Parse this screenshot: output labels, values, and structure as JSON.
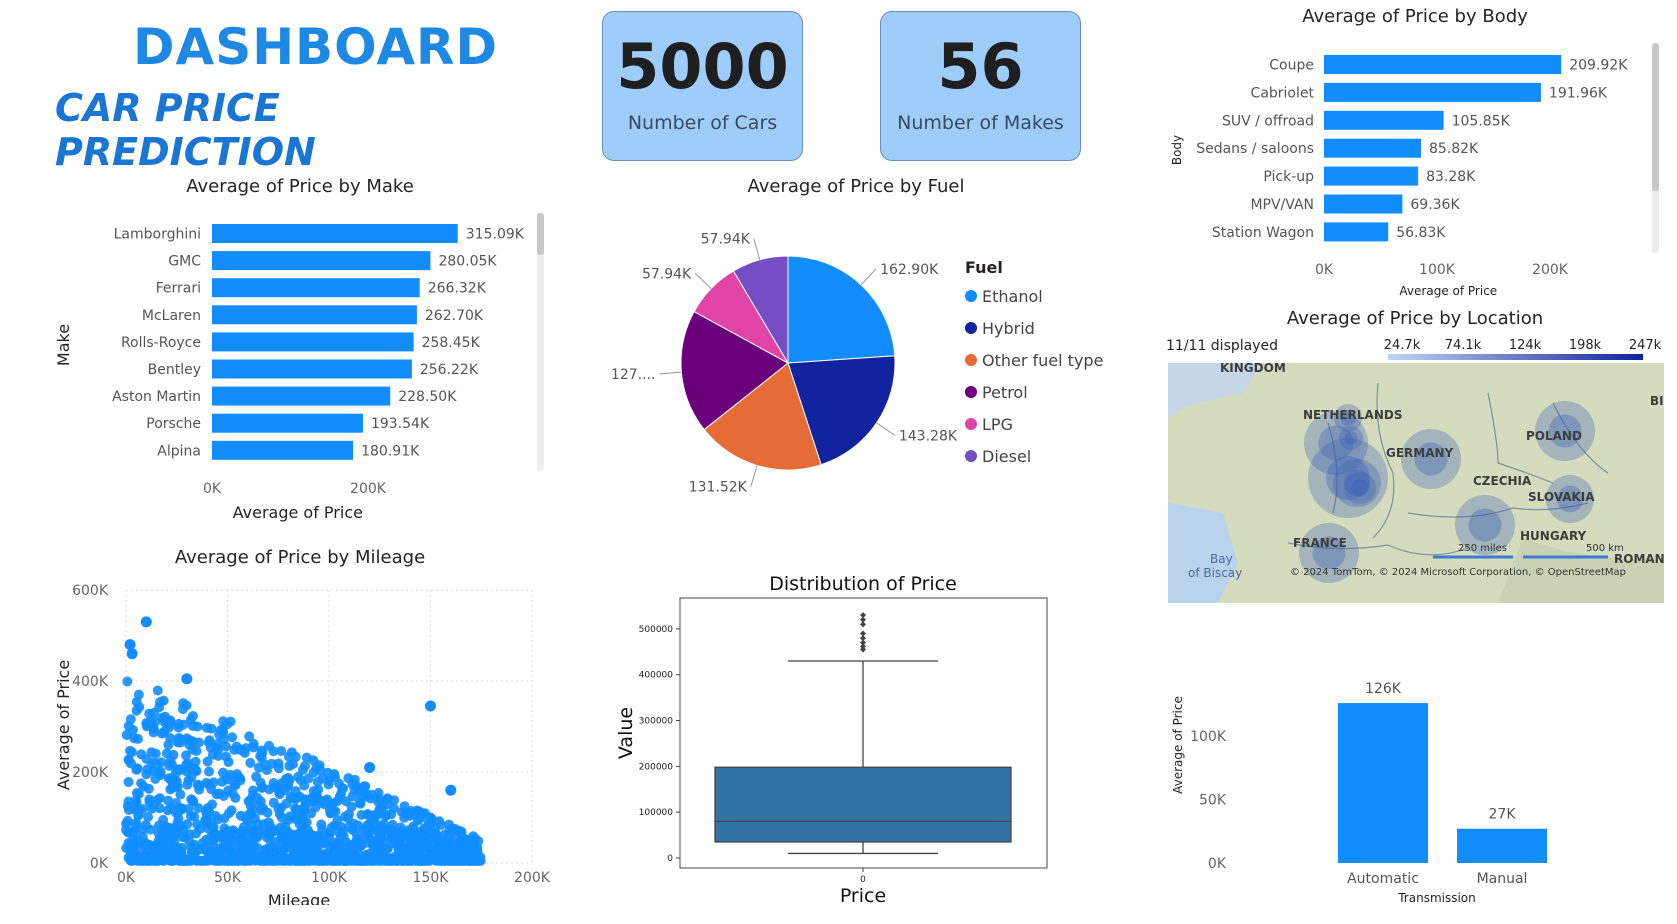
{
  "header": {
    "title": "DASHBOARD",
    "subtitle": "CAR PRICE PREDICTION"
  },
  "kpis": [
    {
      "value": "5000",
      "label": "Number of Cars"
    },
    {
      "value": "56",
      "label": "Number of Makes"
    }
  ],
  "colors": {
    "bar": "#118dff",
    "title": "#1e88e5",
    "kpi_bg": "#9ecdfc",
    "boxplot": "#3274a1",
    "dark_blue": "#12239e"
  },
  "chart_data": [
    {
      "id": "make",
      "type": "bar",
      "orientation": "horizontal",
      "title": "Average of Price by Make",
      "xlabel": "Average of Price",
      "ylabel": "Make",
      "categories": [
        "Lamborghini",
        "GMC",
        "Ferrari",
        "McLaren",
        "Rolls-Royce",
        "Bentley",
        "Aston Martin",
        "Porsche",
        "Alpina"
      ],
      "values": [
        315090,
        280050,
        266320,
        262700,
        258450,
        256220,
        228500,
        193540,
        180910
      ],
      "labels": [
        "315.09K",
        "280.05K",
        "266.32K",
        "262.70K",
        "258.45K",
        "256.22K",
        "228.50K",
        "193.54K",
        "180.91K"
      ],
      "xticks": [
        "0K",
        "200K"
      ],
      "xlim": [
        0,
        200000
      ]
    },
    {
      "id": "body",
      "type": "bar",
      "orientation": "horizontal",
      "title": "Average of Price by Body",
      "xlabel": "Average of Price",
      "ylabel": "Body",
      "categories": [
        "Coupe",
        "Cabriolet",
        "SUV / offroad",
        "Sedans / saloons",
        "Pick-up",
        "MPV/VAN",
        "Station Wagon"
      ],
      "values": [
        209920,
        191960,
        105850,
        85820,
        83280,
        69360,
        56830
      ],
      "labels": [
        "209.92K",
        "191.96K",
        "105.85K",
        "85.82K",
        "83.28K",
        "69.36K",
        "56.83K"
      ],
      "xticks": [
        "0K",
        "100K",
        "200K"
      ],
      "xlim": [
        0,
        200000
      ]
    },
    {
      "id": "fuel",
      "type": "pie",
      "title": "Average of Price by Fuel",
      "legend_title": "Fuel",
      "series": [
        {
          "name": "Ethanol",
          "value": 162900,
          "label": "162.90K",
          "color": "#118dff"
        },
        {
          "name": "Hybrid",
          "value": 143280,
          "label": "143.28K",
          "color": "#12239e"
        },
        {
          "name": "Other fuel type",
          "value": 131520,
          "label": "131.52K",
          "color": "#e66c37"
        },
        {
          "name": "Petrol",
          "value": 127000,
          "label": "127....",
          "color": "#6b007b"
        },
        {
          "name": "LPG",
          "value": 57940,
          "label": "57.94K",
          "color": "#e044a7"
        },
        {
          "name": "Diesel",
          "value": 57940,
          "label": "57.94K",
          "color": "#744ec2"
        }
      ]
    },
    {
      "id": "mileage",
      "type": "scatter",
      "title": "Average of Price by Mileage",
      "xlabel": "Mileage",
      "ylabel": "Average of Price",
      "xticks": [
        "0K",
        "50K",
        "100K",
        "150K",
        "200K"
      ],
      "yticks": [
        "0K",
        "200K",
        "400K",
        "600K"
      ],
      "xlim": [
        0,
        200000
      ],
      "ylim": [
        0,
        600000
      ]
    },
    {
      "id": "box",
      "type": "box",
      "title": "Distribution of Price",
      "xlabel": "Price",
      "ylabel": "Value",
      "categories": [
        "0"
      ],
      "yticks": [
        "0",
        "100000",
        "200000",
        "300000",
        "400000",
        "500000"
      ],
      "ylim": [
        0,
        550000
      ],
      "whisker_low": 10000,
      "q1": 35000,
      "median": 80000,
      "q3": 198000,
      "whisker_high": 430000,
      "outliers": [
        455000,
        462000,
        470000,
        480000,
        490000,
        510000,
        520000,
        530000
      ]
    },
    {
      "id": "transmission",
      "type": "bar",
      "title": "",
      "xlabel": "Transmission",
      "ylabel": "Average of Price",
      "categories": [
        "Automatic",
        "Manual"
      ],
      "values": [
        126000,
        27000
      ],
      "labels": [
        "126K",
        "27K"
      ],
      "yticks": [
        "0K",
        "50K",
        "100K"
      ],
      "ylim": [
        0,
        130000
      ]
    }
  ],
  "map": {
    "title": "Average of Price by Location",
    "displayed": "11/11 displayed",
    "legend_ticks": [
      "24.7k",
      "74.1k",
      "124k",
      "198k",
      "247k"
    ],
    "places": [
      "KINGDOM",
      "NETHERLANDS",
      "GERMANY",
      "POLAND",
      "CZECHIA",
      "SLOVAKIA",
      "FRANCE",
      "HUNGARY",
      "ROMAN",
      "Bay",
      "of Biscay",
      "BI"
    ],
    "scale_miles": "250 miles",
    "scale_km": "500 km",
    "copyright": "© 2024 TomTom, © 2024 Microsoft Corporation, © OpenStreetMap"
  }
}
